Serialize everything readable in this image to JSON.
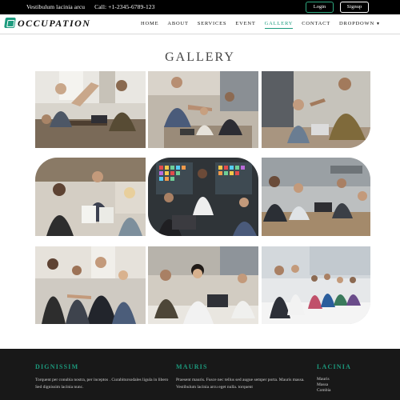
{
  "topbar": {
    "tagline": "Vestibulum lacinia arcu",
    "phone": "Call: +1-2345-6789-123",
    "login_label": "Login",
    "signup_label": "Signup"
  },
  "brand": {
    "name": "OCCUPATION"
  },
  "nav": {
    "items": [
      {
        "label": "HOME"
      },
      {
        "label": "ABOUT"
      },
      {
        "label": "SERVICES"
      },
      {
        "label": "EVENT"
      },
      {
        "label": "GALLERY"
      },
      {
        "label": "CONTACT"
      },
      {
        "label": "DROPDOWN"
      }
    ],
    "active": "GALLERY"
  },
  "gallery": {
    "title": "GALLERY"
  },
  "footer": {
    "col1": {
      "title": "DIGNISSIM",
      "text": "Torquent per conubia nostra, per inceptos . Curabitursodales ligula in libero Sed dignissim lacinia nunc."
    },
    "col2": {
      "title": "MAURIS",
      "text": "Praesent mauris. Fusce nec tellus sed augue semper porta. Mauris massa. Vestibulum lacinia arcu eget nulla. torquent"
    },
    "col3": {
      "title": "LACINIA",
      "items": [
        "Mauris",
        "Massa",
        "Combia"
      ]
    }
  },
  "colors": {
    "accent": "#1c9b7e",
    "topbar_bg": "#000000",
    "footer_bg": "#181818"
  }
}
